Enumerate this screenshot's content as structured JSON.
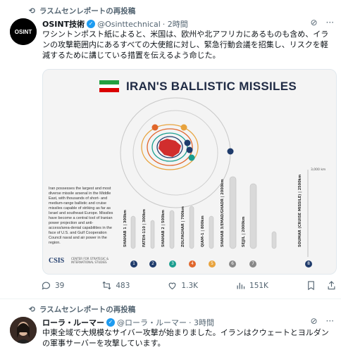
{
  "tweet1": {
    "repost_label": "ラスムセンレポートの再投稿",
    "author_name": "OSINT技術",
    "handle": "@Osinttechnical",
    "time": "· 2時間",
    "text": "ワシントンポスト紙によると、米国は、欧州や北アフリカにあるものも含め、イランの攻撃範囲内にあるすべての大使館に対し、緊急行動会議を招集し、リスクを軽減するために講じている措置を伝えるよう命じた。",
    "media": {
      "title": "IRAN'S BALLISTIC MISSILES",
      "description": "Iran possesses the largest and most diverse missile arsenal in the Middle East, with thousands of short- and medium-range ballistic and cruise missiles capable of striking as far as Israel and southeast Europe. Missiles have become a central tool of Iranian power projection and anti-access/area-denial capabilities in the face of U.S. and Gulf Cooperation Council naval and air power in the region.",
      "org": "CSIS",
      "org_sub": "CENTER FOR STRATEGIC & INTERNATIONAL STUDIES",
      "scale_top": "3,000 km",
      "missiles": [
        {
          "num": "1",
          "label": "SHAHAB 1 | 300km",
          "color": "#1f3b6b"
        },
        {
          "num": "2",
          "label": "FATEH-110 | 300km",
          "color": "#1f3b6b"
        },
        {
          "num": "3",
          "label": "SHAHAB 2 | 500km",
          "color": "#1a9e8f"
        },
        {
          "num": "4",
          "label": "ZOLFAGHAR | 700km",
          "color": "#e0662b"
        },
        {
          "num": "5",
          "label": "QIAM-1 | 800km",
          "color": "#e8a33d"
        },
        {
          "num": "6",
          "label": "SHAHAB 3/EMAD/GHADR | 2000km",
          "color": "#888888"
        },
        {
          "num": "7",
          "label": "SEJJIL | 2000km",
          "color": "#888888"
        },
        {
          "num": "8",
          "label": "SOUMAR (CRUISE MISSILE) | 2500km",
          "color": "#1f3b6b"
        }
      ]
    },
    "actions": {
      "replies": "39",
      "reposts": "483",
      "likes": "1.3K",
      "views": "151K"
    }
  },
  "tweet2": {
    "repost_label": "ラスムセンレポートの再投稿",
    "author_name": "ローラ・ルーマー",
    "handle": "@ローラ・ルーマー",
    "time": "· 3時間",
    "text": "中東全域で大規模なサイバー攻撃が始まりました。イランはクウェートとヨルダンの軍事サーバーを攻撃しています。"
  },
  "colors": {
    "accent": "#1d9bf0",
    "muted": "#536471"
  }
}
